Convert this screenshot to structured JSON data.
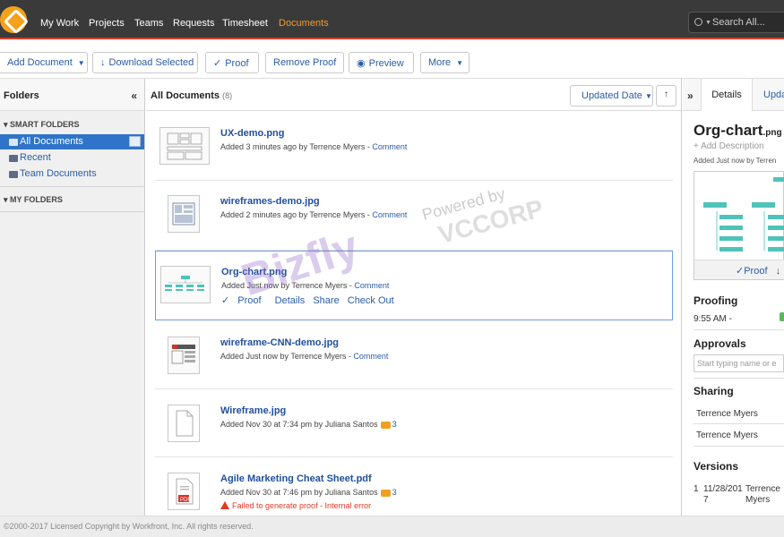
{
  "nav": {
    "items": [
      "My Work",
      "Projects",
      "Teams",
      "Requests",
      "Timesheet",
      "Documents"
    ],
    "active": "Documents",
    "search_placeholder": "Search All..."
  },
  "toolbar": {
    "add_document": "Add Document",
    "download_selected": "Download Selected",
    "proof": "Proof",
    "remove_proof": "Remove Proof",
    "preview": "Preview",
    "more": "More"
  },
  "folders": {
    "title": "Folders",
    "collapse_symbol": "«",
    "smart_folders_label": "SMART FOLDERS",
    "smart_items": [
      "All Documents",
      "Recent",
      "Team Documents"
    ],
    "my_folders_label": "MY FOLDERS"
  },
  "doclist": {
    "title": "All Documents",
    "count": "(8)",
    "sort_label": "Updated Date",
    "documents": [
      {
        "name": "UX-demo.png",
        "meta": "Added 3 minutes ago by Terrence Myers",
        "comment": "Comment"
      },
      {
        "name": "wireframes-demo.jpg",
        "meta": "Added 2 minutes ago by Terrence Myers",
        "comment": "Comment"
      },
      {
        "name": "Org-chart.png",
        "meta": "Added Just now by Terrence Myers",
        "comment": "Comment",
        "actions": [
          "Proof",
          "Details",
          "Share",
          "Check Out"
        ]
      },
      {
        "name": "wireframe-CNN-demo.jpg",
        "meta": "Added Just now by Terrence Myers",
        "comment": "Comment"
      },
      {
        "name": "Wireframe.jpg",
        "meta": "Added Nov 30 at 7:34 pm by Juliana Santos",
        "comments_count": "3"
      },
      {
        "name": "Agile Marketing Cheat Sheet.pdf",
        "meta": "Added Nov 30 at 7:46 pm by Juliana Santos",
        "comments_count": "3",
        "error": "Failed to generate proof - Internal error"
      }
    ]
  },
  "watermark": {
    "brand": "Bizfly",
    "powered": "Powered by",
    "corp": "VCCORP"
  },
  "details": {
    "expand_symbol": "»",
    "tabs": [
      "Details",
      "Upda"
    ],
    "doc_title": "Org-chart",
    "doc_ext": ".png",
    "add_description": "+ Add Description",
    "added": "Added Just now by Terren",
    "preview_proof": "Proof",
    "proofing_label": "Proofing",
    "proofing_time": "9:55 AM  -",
    "approvals_label": "Approvals",
    "approvals_placeholder": "Start typing name or e",
    "sharing_label": "Sharing",
    "sharing_people": [
      "Terrence Myers",
      "Terrence Myers"
    ],
    "versions_label": "Versions",
    "version_row": {
      "num": "1",
      "date_a": "11/28/201",
      "date_b": "7",
      "user_a": "Terrence",
      "user_b": "Myers"
    }
  },
  "footer": {
    "copyright": "©2000-2017 Licensed Copyright by Workfront, Inc. All rights reserved."
  }
}
